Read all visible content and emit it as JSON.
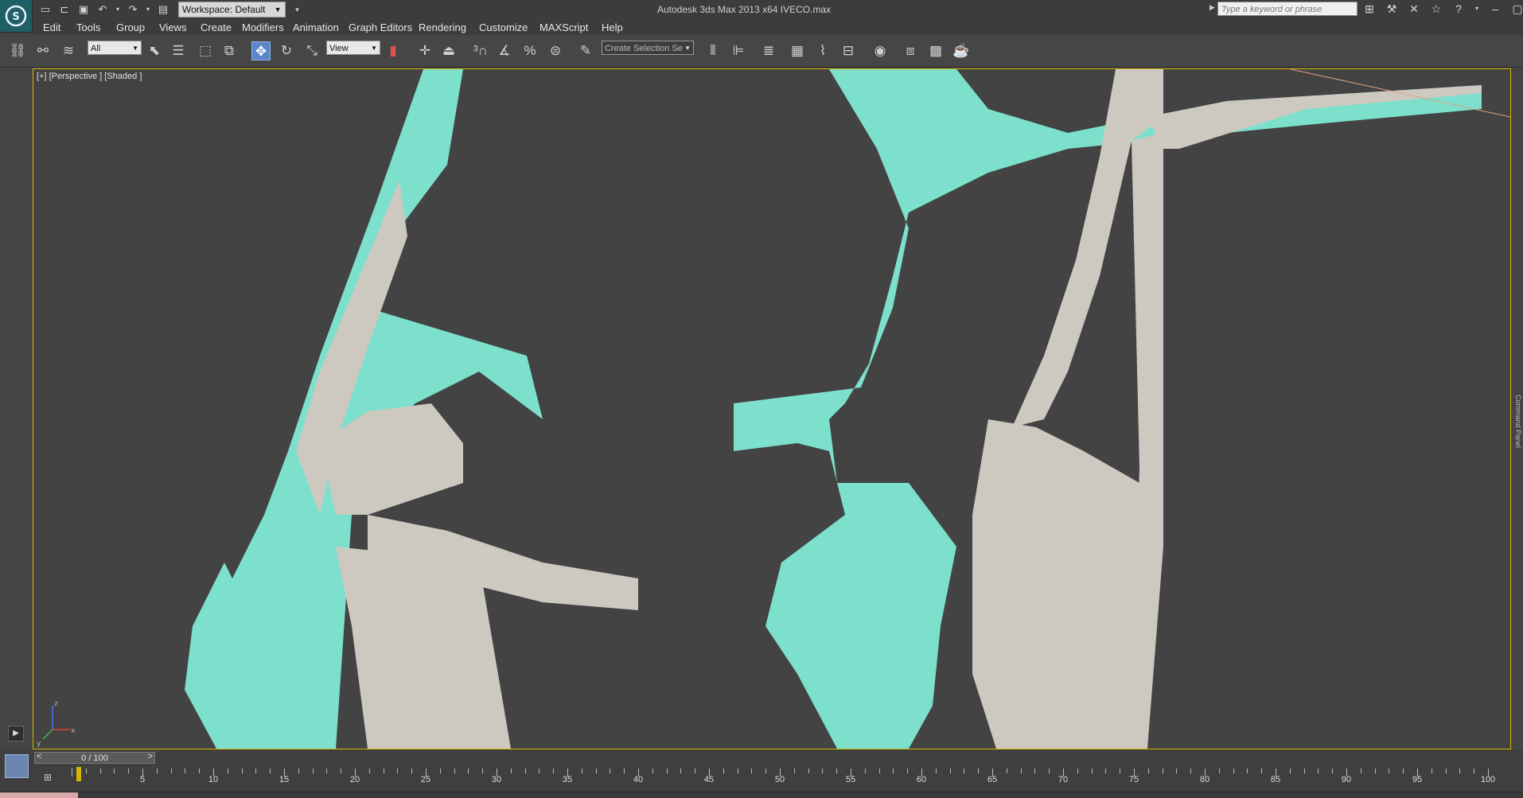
{
  "title_bar": {
    "workspace_label": "Workspace: Default",
    "app_title": "Autodesk 3ds Max  2013 x64      IVECO.max",
    "search_placeholder": "Type a keyword or phrase"
  },
  "menu": [
    "Edit",
    "Tools",
    "Group",
    "Views",
    "Create",
    "Modifiers",
    "Animation",
    "Graph Editors",
    "Rendering",
    "Customize",
    "MAXScript",
    "Help"
  ],
  "toolbar": {
    "selection_filter": "All",
    "reference_coord": "View",
    "named_selection": "Create Selection Se"
  },
  "viewport": {
    "label": "[+] [Perspective ] [Shaded ]",
    "mesh_color": "#7ce0cc",
    "model_color": "#cdc9c1",
    "axes": {
      "x": "x",
      "y": "y",
      "z": "z"
    }
  },
  "timeline": {
    "frame_display": "0 / 100",
    "prev": "<",
    "next": ">",
    "current_frame": 0,
    "tick_labels": [
      "5",
      "10",
      "15",
      "20",
      "25",
      "30",
      "35",
      "40",
      "45",
      "50",
      "55",
      "60",
      "65",
      "70",
      "75",
      "80",
      "85",
      "90",
      "95",
      "100"
    ]
  },
  "command_panel": {
    "label": "Command Panel"
  }
}
